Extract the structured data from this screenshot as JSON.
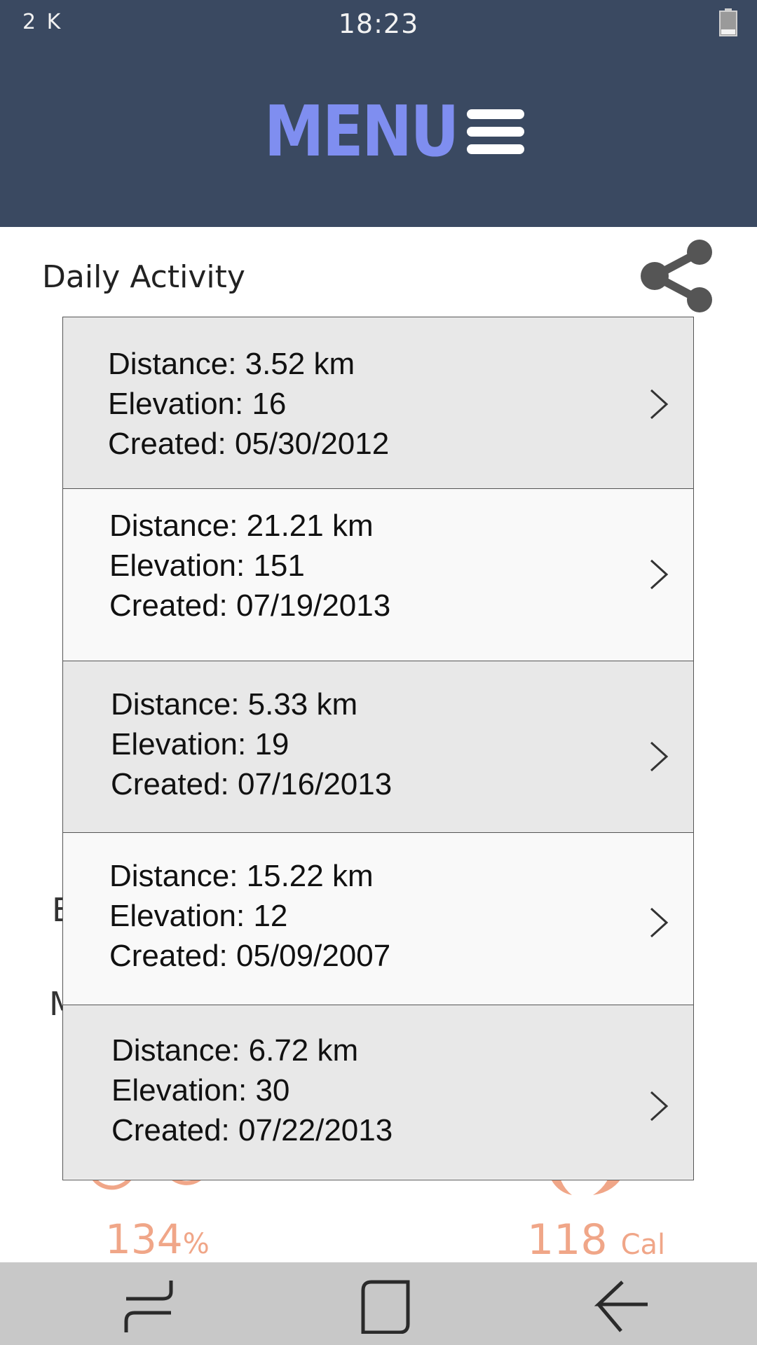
{
  "status_bar": {
    "left_text": "2 K",
    "time": "18:23"
  },
  "header": {
    "menu_label": "MENU"
  },
  "section": {
    "title": "Daily Activity"
  },
  "behind": {
    "peek1": "E",
    "peek2": "M"
  },
  "metrics": {
    "left_value": "134",
    "left_unit": "%",
    "right_value": "118",
    "right_unit": "Cal"
  },
  "activities": [
    {
      "distance": "Distance: 3.52 km",
      "elevation": "Elevation: 16",
      "created": "Created: 05/30/2012"
    },
    {
      "distance": "Distance: 21.21 km",
      "elevation": "Elevation: 151",
      "created": "Created: 07/19/2013"
    },
    {
      "distance": "Distance: 5.33 km",
      "elevation": "Elevation: 19",
      "created": "Created: 07/16/2013"
    },
    {
      "distance": "Distance: 15.22 km",
      "elevation": "Elevation: 12",
      "created": "Created: 05/09/2007"
    },
    {
      "distance": "Distance: 6.72 km",
      "elevation": "Elevation: 30",
      "created": "Created: 07/22/2013"
    }
  ],
  "colors": {
    "header_bg": "#3a4961",
    "menu_text": "#7f8ef0",
    "accent_orange": "#f0a688",
    "row_shaded": "#e8e8e8",
    "row_light": "#f9f9f9",
    "nav_bg": "#c8c8c8"
  },
  "icons": {
    "hamburger": "hamburger-icon",
    "share": "share-icon",
    "chevron": "chevron-right-icon",
    "recents": "recent-apps-icon",
    "home": "home-icon",
    "back": "back-icon",
    "battery": "battery-icon"
  }
}
